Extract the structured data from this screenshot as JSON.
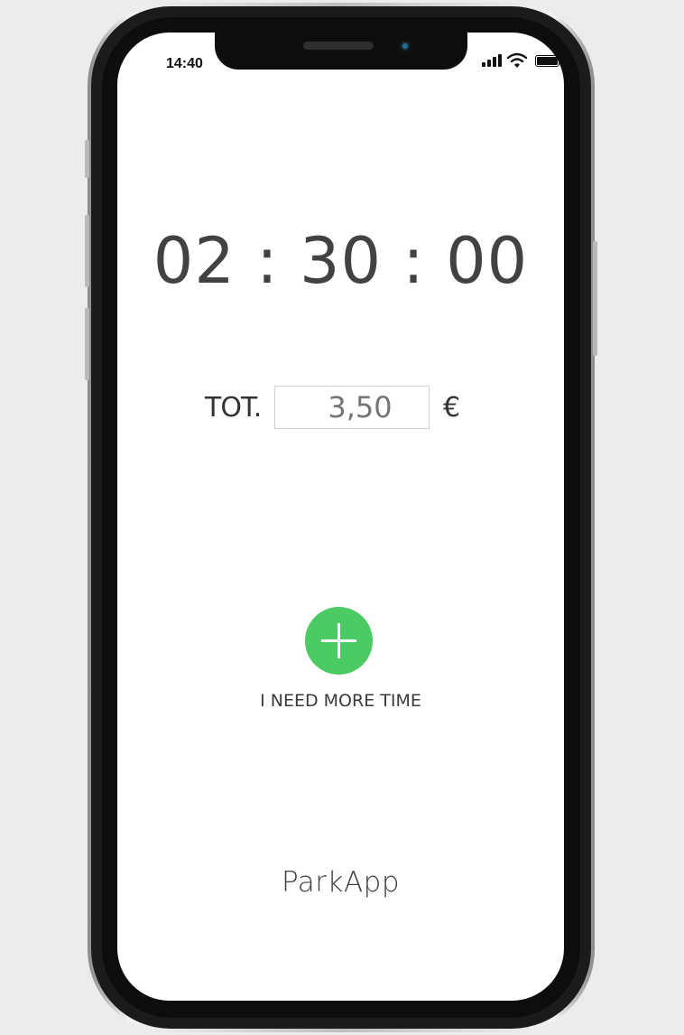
{
  "status_bar": {
    "time": "14:40",
    "icons": [
      "signal-icon",
      "wifi-icon",
      "battery-icon"
    ]
  },
  "timer": {
    "display": "02 : 30 : 00"
  },
  "total": {
    "label": "TOT.",
    "amount_placeholder": "3,50",
    "currency": "€"
  },
  "add_time": {
    "icon": "plus-icon",
    "label": "I NEED MORE TIME",
    "color": "#4cca63"
  },
  "app": {
    "name": "ParkApp"
  }
}
